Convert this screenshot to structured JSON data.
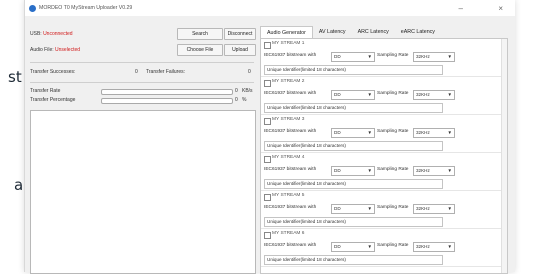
{
  "background": {
    "line1": "st",
    "line2": "a"
  },
  "window": {
    "title": "MORDEO T0 MyStream Uploader V0.29",
    "controls": {
      "minimize": "–",
      "close": "×"
    }
  },
  "status": {
    "usb_label": "USB:",
    "usb_value": "Unconnected",
    "audio_label": "Audio File:",
    "audio_value": "Unselected"
  },
  "buttons": {
    "search": "Search",
    "disconnect": "Disconnect",
    "choose_file": "Choose File",
    "upload": "Upload"
  },
  "transfer": {
    "successes_label": "Transfer Successes:",
    "successes_value": "0",
    "failures_label": "Transfer Failures:",
    "failures_value": "0",
    "rate_label": "Transfer Rate",
    "rate_value": "0",
    "rate_unit": "KB/s",
    "rate_fraction": 0,
    "percent_label": "Transfer Percentage",
    "percent_value": "0",
    "percent_unit": "%",
    "percent_fraction": 0
  },
  "tabs": [
    {
      "label": "Audio Generator",
      "active": true
    },
    {
      "label": "AV Latency",
      "active": false
    },
    {
      "label": "ARC Latency",
      "active": false
    },
    {
      "label": "eARC Latency",
      "active": false
    }
  ],
  "streams": [
    {
      "name": "MY STREAM 1",
      "bitstream_label": "IEC61937 bitstream with",
      "bitstream_value": "DD",
      "rate_label": "Sampling Rate",
      "rate_value": "32KHz",
      "uid_placeholder": "Unique Identifier(limited 18 characters)"
    },
    {
      "name": "MY STREAM 2",
      "bitstream_label": "IEC61937 bitstream with",
      "bitstream_value": "DD",
      "rate_label": "Sampling Rate",
      "rate_value": "32KHz",
      "uid_placeholder": "Unique Identifier(limited 18 characters)"
    },
    {
      "name": "MY STREAM 3",
      "bitstream_label": "IEC61937 bitstream with",
      "bitstream_value": "DD",
      "rate_label": "Sampling Rate",
      "rate_value": "32KHz",
      "uid_placeholder": "Unique Identifier(limited 18 characters)"
    },
    {
      "name": "MY STREAM 4",
      "bitstream_label": "IEC61937 bitstream with",
      "bitstream_value": "DD",
      "rate_label": "Sampling Rate",
      "rate_value": "32KHz",
      "uid_placeholder": "Unique Identifier(limited 18 characters)"
    },
    {
      "name": "MY STREAM 5",
      "bitstream_label": "IEC61937 bitstream with",
      "bitstream_value": "DD",
      "rate_label": "Sampling Rate",
      "rate_value": "32KHz",
      "uid_placeholder": "Unique Identifier(limited 18 characters)"
    },
    {
      "name": "MY STREAM 6",
      "bitstream_label": "IEC61937 bitstream with",
      "bitstream_value": "DD",
      "rate_label": "Sampling Rate",
      "rate_value": "32KHz",
      "uid_placeholder": "Unique Identifier(limited 18 characters)"
    }
  ],
  "icons": {
    "app": "app-icon",
    "dropdown": "chevron-down-icon"
  },
  "colors": {
    "error_text": "#d01818",
    "accent": "#2a6fc8"
  }
}
